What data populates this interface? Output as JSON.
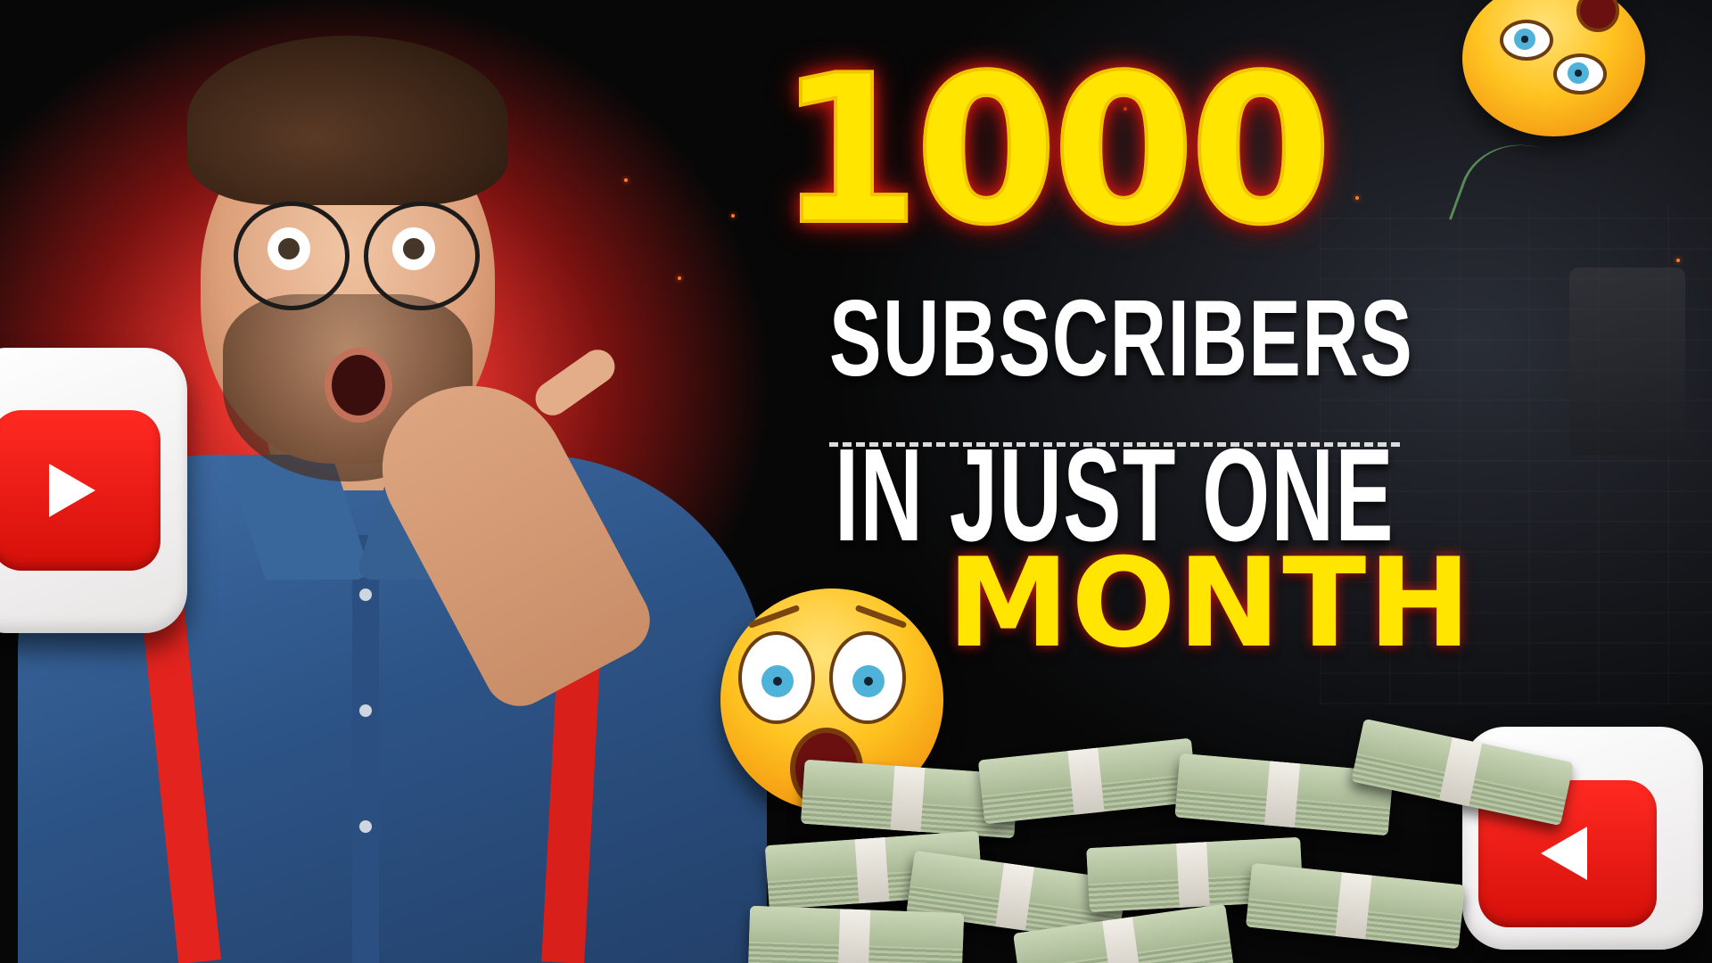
{
  "headline": {
    "number": "1000",
    "line2": "SUBSCRIBERS",
    "line3": "IN JUST ONE",
    "line4": "MONTH"
  },
  "colors": {
    "accent_yellow": "#ffe500",
    "glow_red": "#e41a12",
    "text_white": "#ffffff",
    "youtube_red": "#ff2a22"
  },
  "icons": [
    "youtube-logo-icon",
    "shocked-emoji-icon",
    "money-stack-icon"
  ]
}
